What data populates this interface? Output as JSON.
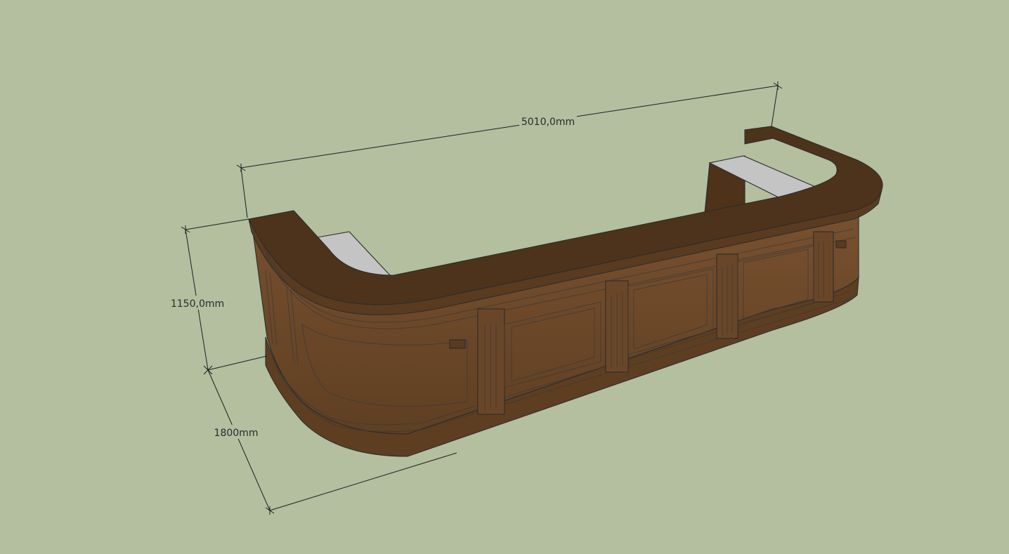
{
  "viewport": {
    "background_color": "#b3bf9f"
  },
  "model": {
    "colors": {
      "top": "#4d331c",
      "face": "#6e4a2a",
      "face_light": "#7a5230",
      "face_dark": "#5a3b20",
      "countertop_gray": "#c4c4c4"
    }
  },
  "dimensions": {
    "length": "5010,0mm",
    "height": "1150,0mm",
    "depth": "1800mm"
  }
}
